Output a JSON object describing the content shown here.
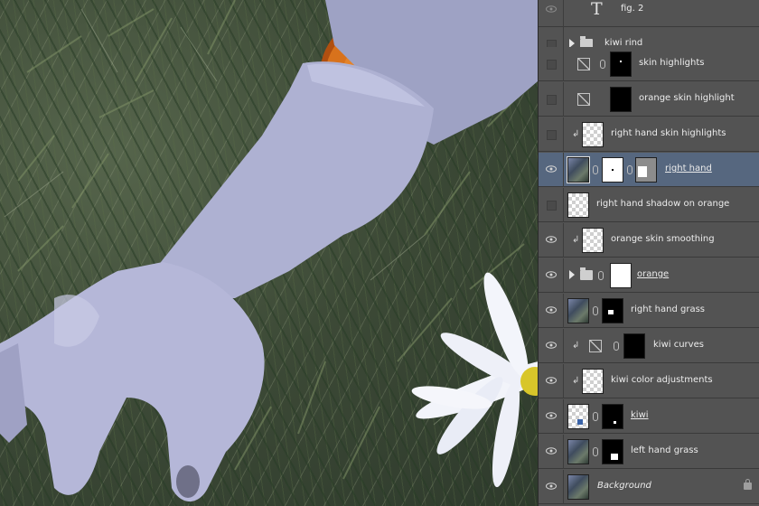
{
  "colors": {
    "panel_bg": "#535353",
    "selected_row": "#56677f",
    "text": "#ececec"
  },
  "layers": [
    {
      "name": "fig. 2",
      "type": "text",
      "visible": "hidden-eye"
    },
    {
      "name": "kiwi rind",
      "type": "group",
      "visible": "off"
    },
    {
      "name": "skin highlights",
      "type": "curves-masked",
      "visible": "off"
    },
    {
      "name": "orange skin highlight",
      "type": "curves-masked",
      "visible": "off"
    },
    {
      "name": "right hand skin highlights",
      "type": "clipped-pixel",
      "visible": "off"
    },
    {
      "name": "right hand",
      "type": "smart-masked",
      "visible": "on",
      "selected": true
    },
    {
      "name": "right hand shadow on orange",
      "type": "pixel",
      "visible": "off"
    },
    {
      "name": "orange skin smoothing",
      "type": "clipped-pixel",
      "visible": "on"
    },
    {
      "name": "orange",
      "type": "group-masked",
      "visible": "on"
    },
    {
      "name": "right hand grass",
      "type": "photo-masked",
      "visible": "on"
    },
    {
      "name": "kiwi curves",
      "type": "clipped-curves",
      "visible": "on"
    },
    {
      "name": "kiwi color adjustments",
      "type": "clipped-pixel",
      "visible": "on"
    },
    {
      "name": "kiwi",
      "type": "pixel-masked",
      "visible": "on"
    },
    {
      "name": "left hand grass",
      "type": "photo-masked",
      "visible": "on"
    },
    {
      "name": "Background",
      "type": "background",
      "visible": "on",
      "locked": true
    }
  ]
}
